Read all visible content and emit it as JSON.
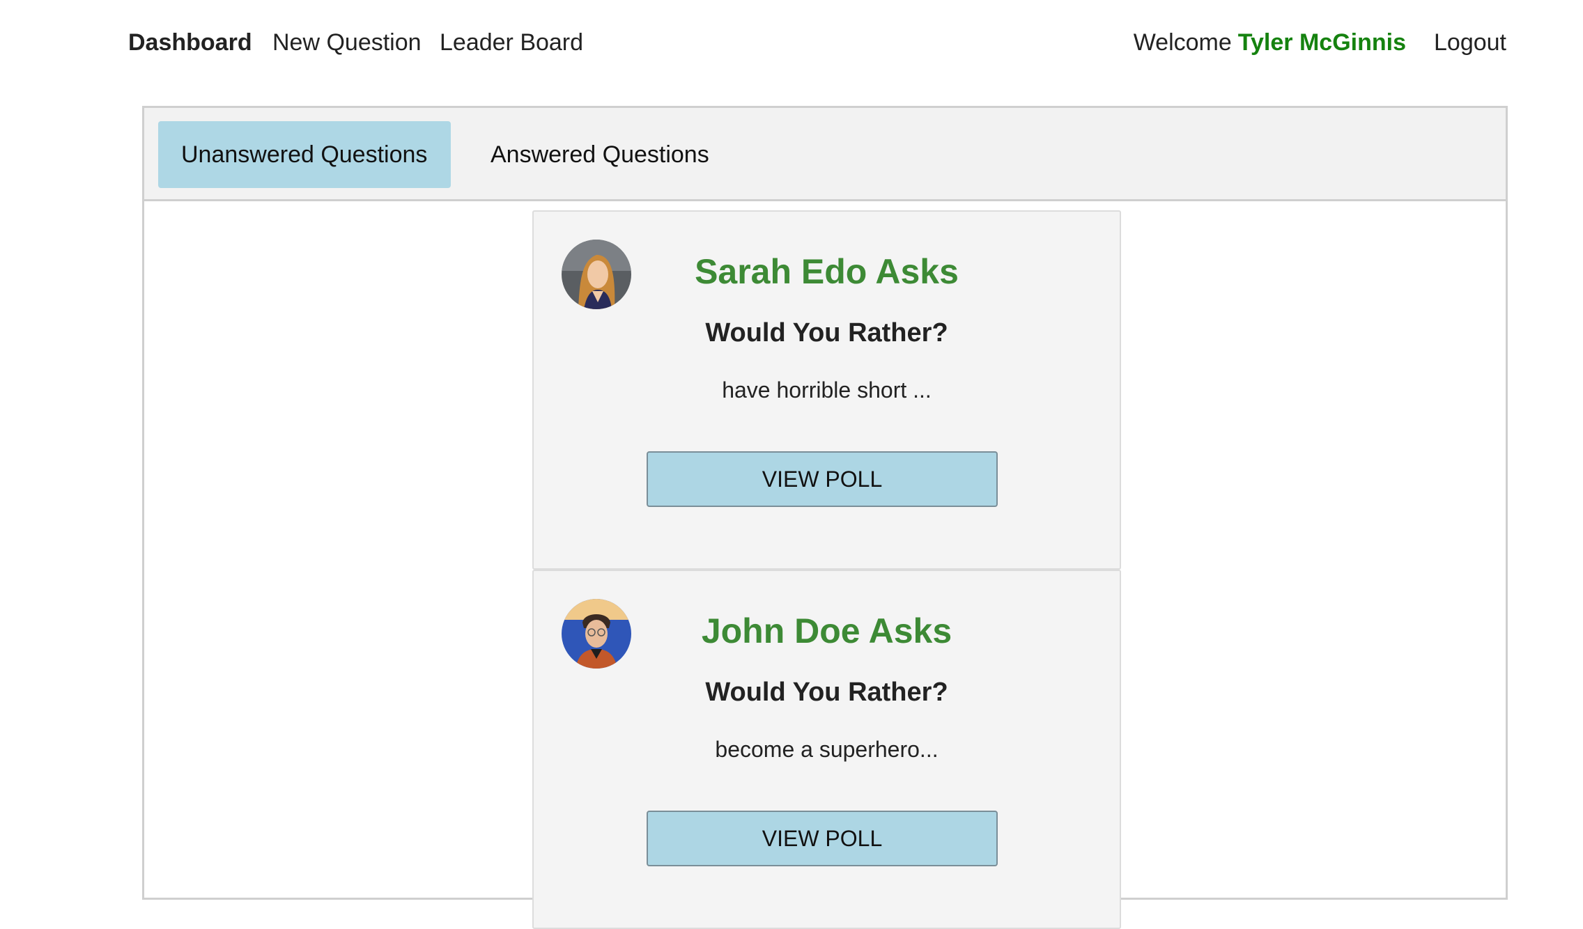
{
  "nav": {
    "dashboard": "Dashboard",
    "new_question": "New Question",
    "leader_board": "Leader Board",
    "welcome": "Welcome",
    "username": "Tyler McGinnis",
    "logout": "Logout"
  },
  "tabs": {
    "unanswered": "Unanswered Questions",
    "answered": "Answered Questions"
  },
  "questions": [
    {
      "title": "Sarah Edo Asks",
      "heading": "Would You Rather?",
      "preview": "have horrible short ...",
      "button": "VIEW POLL"
    },
    {
      "title": "John Doe Asks",
      "heading": "Would You Rather?",
      "preview": "become a superhero...",
      "button": "VIEW POLL"
    }
  ],
  "colors": {
    "accent_green": "#3d8a35",
    "username_green": "#15820f",
    "tab_active": "#aed7e5",
    "button_bg": "#add6e4"
  }
}
